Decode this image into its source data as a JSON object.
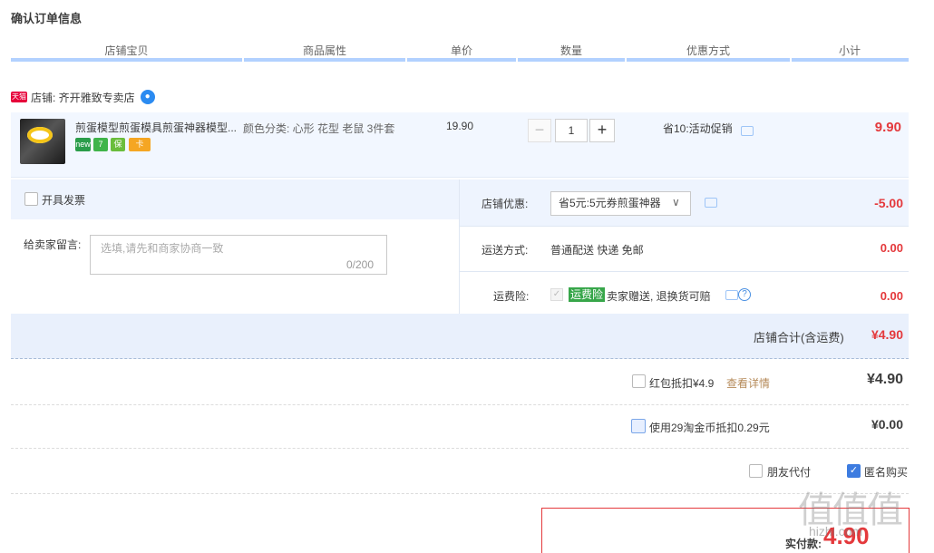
{
  "page": {
    "title": "确认订单信息"
  },
  "columns": [
    "店铺宝贝",
    "商品属性",
    "单价",
    "数量",
    "优惠方式",
    "小计"
  ],
  "shop": {
    "badge": "天猫",
    "label": "店铺: 齐开雅致专卖店"
  },
  "item": {
    "name": "煎蛋模型煎蛋模具煎蛋神器模型...",
    "attributes": "颜色分类: 心形 花型 老鼠 3件套",
    "price": "19.90",
    "quantity": "1",
    "minus": "−",
    "plus": "+",
    "promotion": "省10:活动促销",
    "subtotal": "9.90",
    "tags": [
      {
        "text": "new",
        "color": "#2a9d4a"
      },
      {
        "text": "7",
        "color": "#3fb44a"
      },
      {
        "text": "保",
        "color": "#6abd3c"
      },
      {
        "text": "卡",
        "color": "#f5a623"
      }
    ]
  },
  "invoice": {
    "label": "开具发票"
  },
  "message": {
    "label": "给卖家留言:",
    "placeholder": "选填,请先和商家协商一致",
    "count": "0/200"
  },
  "shop_discount": {
    "label": "店铺优惠:",
    "selected": "省5元:5元券煎蛋神器",
    "amount": "-5.00"
  },
  "shipping": {
    "label": "运送方式:",
    "value": "普通配送 快递 免邮",
    "amount": "0.00"
  },
  "insurance": {
    "label": "运费险:",
    "badge": "运费险",
    "text": "卖家赠送, 退换货可赔",
    "amount": "0.00"
  },
  "shop_total": {
    "label": "店铺合计(含运费)",
    "amount": "¥4.90"
  },
  "red_packet": {
    "label": "红包抵扣¥4.9",
    "link": "查看详情",
    "amount": "¥4.90"
  },
  "coins": {
    "label": "使用29淘金币抵扣0.29元",
    "amount": "¥0.00"
  },
  "friend_pay": {
    "label": "朋友代付"
  },
  "anonymous": {
    "label": "匿名购买",
    "checked": true
  },
  "payment": {
    "label": "实付款:",
    "amount": "4.90"
  },
  "watermark": {
    "text": "值值值",
    "url": "hizhi.com"
  }
}
